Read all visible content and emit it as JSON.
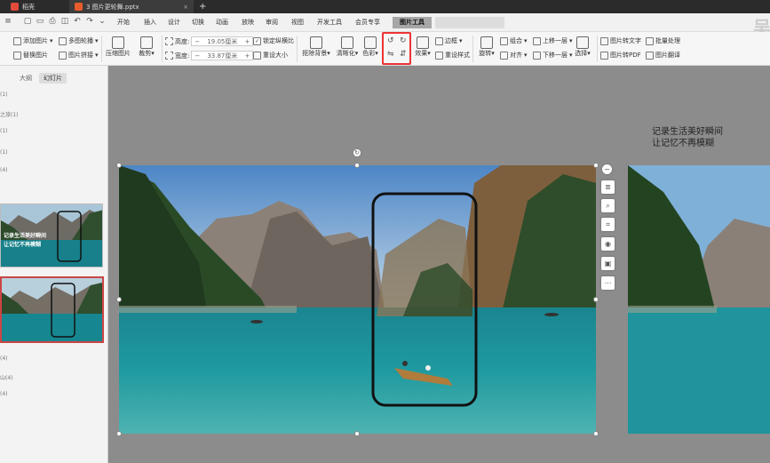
{
  "titlebar": {
    "tabs": [
      {
        "label": "稻壳"
      },
      {
        "label": "3 图片更轮舞.pptx"
      }
    ],
    "new_tab": "+"
  },
  "menubar": {
    "items": [
      "开始",
      "插入",
      "设计",
      "切换",
      "动画",
      "放映",
      "审阅",
      "视图",
      "开发工具",
      "会员专享",
      "图片工具"
    ],
    "active": "图片工具",
    "right_logo": "吴"
  },
  "ribbon": {
    "add_picture": "添加图片",
    "replace_picture": "替换图片",
    "multi_picture": "多图轮播",
    "picture_collage": "图片拼接",
    "compress": "压缩图片",
    "crop": "裁剪",
    "height_label": "高度:",
    "height_value": "19.05厘米",
    "width_label": "宽度:",
    "width_value": "33.87厘米",
    "lock_ratio": "锁定纵横比",
    "reset_size": "重设大小",
    "remove_bg": "抠除背景",
    "clarify": "清晰化",
    "color": "色彩",
    "effects": "效果",
    "border": "边框",
    "reset_style": "重设样式",
    "rotate": "旋转",
    "group": "组合",
    "align": "对齐",
    "bring_forward": "上移一层",
    "send_backward": "下移一层",
    "select": "选择",
    "pic_to_text": "图片转文字",
    "pic_to_pdf": "图片转PDF",
    "batch": "批量处理",
    "translate": "图片翻译"
  },
  "leftpanel": {
    "tabs": [
      "大纲",
      "幻灯片"
    ],
    "active_tab": "幻灯片",
    "outline_fragments": [
      "(1)",
      "之旅(1)",
      "(1)",
      "(1)",
      "(4)",
      "(4)",
      "山(4)",
      "(4)",
      "机(1)"
    ],
    "thumb_caption_1": "记录生活美好瞬间",
    "thumb_caption_2": "让记忆不再模糊"
  },
  "slide": {
    "caption_line1": "记录生活美好瞬间",
    "caption_line2": "让记忆不再模糊"
  },
  "side_tools": [
    "minus-icon",
    "layers-icon",
    "zoom-icon",
    "crop-icon",
    "pin-icon",
    "image-icon",
    "more-icon"
  ],
  "colors": {
    "accent": "#e33333",
    "canvas_bg": "#8c8c8c",
    "water": "#1f8a8f"
  }
}
